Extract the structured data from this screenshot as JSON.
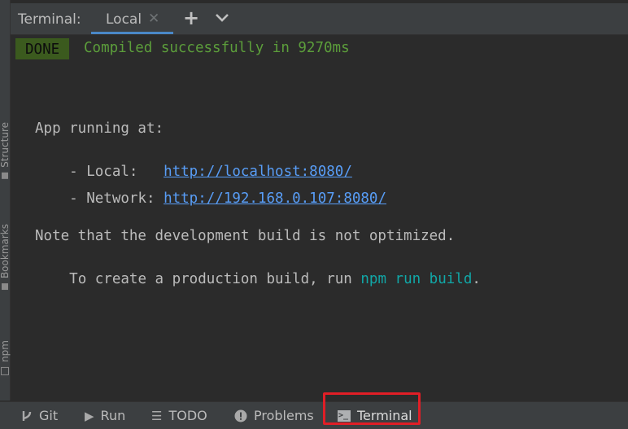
{
  "header": {
    "title": "Terminal:",
    "tabs": [
      {
        "label": "Local",
        "active": true
      }
    ],
    "add_tab_icon": "plus-icon",
    "more_icon": "chevron-down-icon"
  },
  "sidebar": {
    "items": [
      {
        "label": "Structure",
        "icon": "structure-icon"
      },
      {
        "label": "Bookmarks",
        "icon": "bookmark-icon"
      },
      {
        "label": "npm",
        "icon": "npm-icon"
      }
    ]
  },
  "terminal": {
    "badge": "DONE",
    "compiled": "Compiled successfully in 9270ms",
    "app_running": "App running at:",
    "local_label": "- Local:   ",
    "local_url": "http://localhost:8080/",
    "network_label": "- Network: ",
    "network_url": "http://192.168.0.107:8080/",
    "note": "Note that the development build is not optimized.",
    "prod_prefix": "To create a production build, run ",
    "prod_cmd": "npm run build",
    "prod_suffix": "."
  },
  "bottom_bar": {
    "items": [
      {
        "label": "Git",
        "icon": "git-branch-icon"
      },
      {
        "label": "Run",
        "icon": "play-icon"
      },
      {
        "label": "TODO",
        "icon": "list-icon"
      },
      {
        "label": "Problems",
        "icon": "exclamation-icon"
      },
      {
        "label": "Terminal",
        "icon": "terminal-icon",
        "highlighted": true
      }
    ]
  },
  "colors": {
    "accent": "#4a88c7",
    "success": "#5c9e3b",
    "link": "#589df6",
    "command": "#11a7a7",
    "highlight_border": "#e01e26"
  }
}
